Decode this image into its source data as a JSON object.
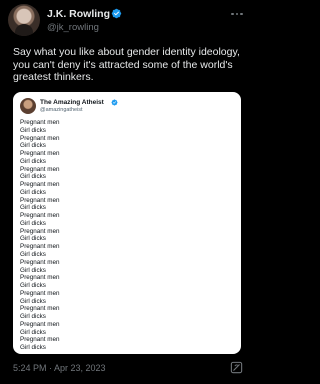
{
  "author": {
    "display_name": "J.K. Rowling",
    "handle": "@jk_rowling"
  },
  "tweet": {
    "text": "Say what you like about gender identity ideology, you can't deny it's attracted some of the world's greatest thinkers."
  },
  "quoted_tweet": {
    "display_name": "The Amazing Atheist",
    "handle": "@amazingatheist",
    "lines": [
      "Pregnant men",
      "Girl dicks",
      "Pregnant men",
      "Girl dicks",
      "Pregnant men",
      "Girl dicks",
      "Pregnant men",
      "Girl dicks",
      "Pregnant men",
      "Girl dicks",
      "Pregnant men",
      "Girl dicks",
      "Pregnant men",
      "Girl dicks",
      "Pregnant men",
      "Girl dicks",
      "Pregnant men",
      "Girl dicks",
      "Pregnant men",
      "Girl dicks",
      "Pregnant men",
      "Girl dicks",
      "Pregnant men",
      "Girl dicks",
      "Pregnant men",
      "Girl dicks",
      "Pregnant men",
      "Girl dicks",
      "Pregnant men",
      "Girl dicks"
    ]
  },
  "meta": {
    "timestamp": "5:24 PM · Apr 23, 2023"
  },
  "icons": {
    "verified": "verified-badge-icon",
    "more": "more-options-icon",
    "grok": "grok-icon"
  },
  "colors": {
    "background": "#000000",
    "text": "#e7e9ea",
    "secondary": "#71767b",
    "verified": "#1d9bf0",
    "card": "#ffffff"
  }
}
